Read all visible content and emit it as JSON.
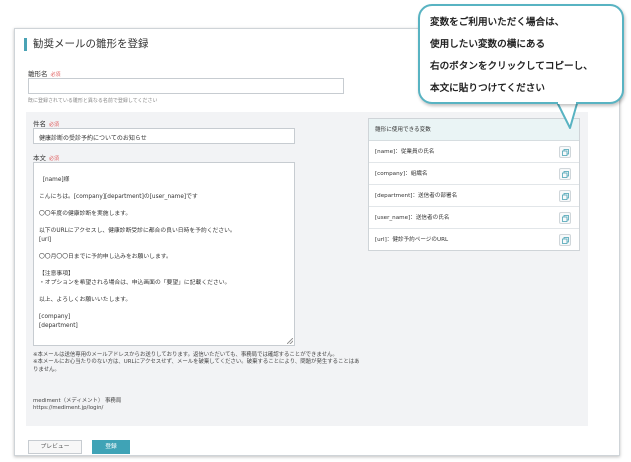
{
  "page": {
    "title": "勧奨メールの雛形を登録"
  },
  "template_name": {
    "label": "雛形名",
    "required": "必須",
    "value": "",
    "hint": "既に登録されている雛形と異なる名前で登録してください"
  },
  "subject": {
    "label": "件名",
    "required": "必須",
    "value": "健康診断の受診予約についてのお知らせ"
  },
  "body": {
    "label": "本文",
    "required": "必須",
    "value": "[name]様\n\nこんにちは。[company][department]の[user_name]です\n\n〇〇年度の健康診断を実施します。\n\n以下のURLにアクセスし、健康診断受診に都合の良い日時を予約ください。\n[url]\n\n〇〇月〇〇日までに予約申し込みをお願いします。\n\n【注意事項】\n・オプションを希望される場合は、申込画面の「要望」に記載ください。\n\n以上、よろしくお願いいたします。\n\n[company]\n[department]"
  },
  "notes": "※本メールは送信専用のメールアドレスからお送りしております。返信いただいても、事務局では確認することができません。\n※本メールにお心当たりのない方は、URLにアクセスせず、メールを破棄してください。破棄することにより、問題が発生することはありません。",
  "signature": "mediment（メディメント） 事務局\nhttps://mediment.jp/login/",
  "buttons": {
    "preview": "プレビュー",
    "submit": "登録"
  },
  "variables": {
    "header": "雛形に使用できる変数",
    "items": [
      {
        "label": "[name]：従業員の氏名"
      },
      {
        "label": "[company]：組織名"
      },
      {
        "label": "[department]：送信者の部署名"
      },
      {
        "label": "[user_name]：送信者の氏名"
      },
      {
        "label": "[url]：健診予約ページのURL"
      }
    ]
  },
  "callout": {
    "lines": [
      "変数をご利用いただく場合は、",
      "使用したい変数の横にある",
      "右のボタンをクリックしてコピーし、",
      "本文に貼りつけてください"
    ]
  },
  "colors": {
    "accent": "#3fa3b6",
    "callout_border": "#58b3c2",
    "required": "#e05a5a"
  }
}
